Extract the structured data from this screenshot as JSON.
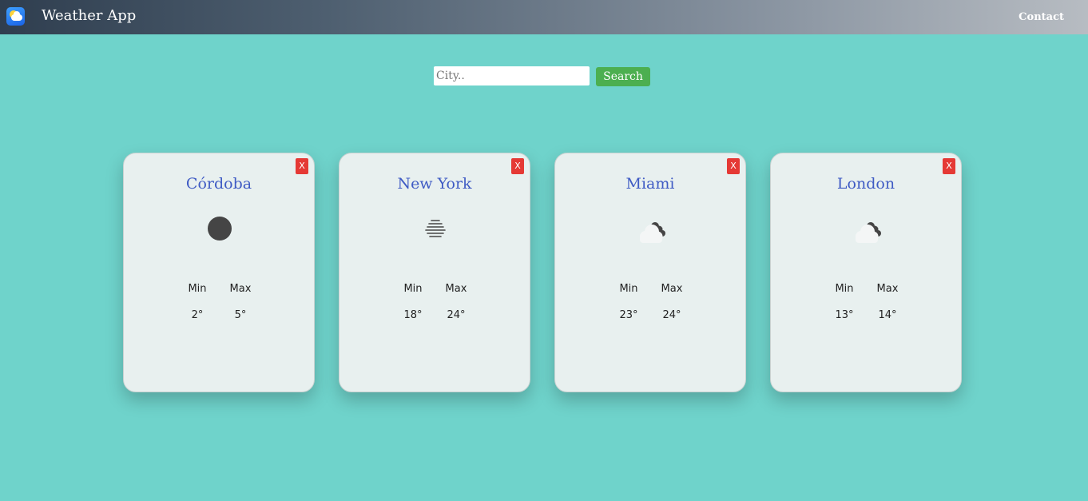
{
  "app": {
    "title": "Weather App",
    "logo": "weather-app-logo"
  },
  "nav": {
    "contact_label": "Contact"
  },
  "search": {
    "placeholder": "City..",
    "value": "",
    "button_label": "Search"
  },
  "labels": {
    "min": "Min",
    "max": "Max",
    "close": "X"
  },
  "cities": [
    {
      "name": "Córdoba",
      "icon": "clear-night-icon",
      "min": "2°",
      "max": "5°"
    },
    {
      "name": "New York",
      "icon": "mist-icon",
      "min": "18°",
      "max": "24°"
    },
    {
      "name": "Miami",
      "icon": "broken-clouds-icon",
      "min": "23°",
      "max": "24°"
    },
    {
      "name": "London",
      "icon": "broken-clouds-icon",
      "min": "13°",
      "max": "14°"
    }
  ],
  "colors": {
    "background": "#6fd3cb",
    "city_name": "#3f5bc4",
    "search_button": "#4caf50",
    "close_button": "#e53935",
    "card": "#e8f0ef"
  }
}
